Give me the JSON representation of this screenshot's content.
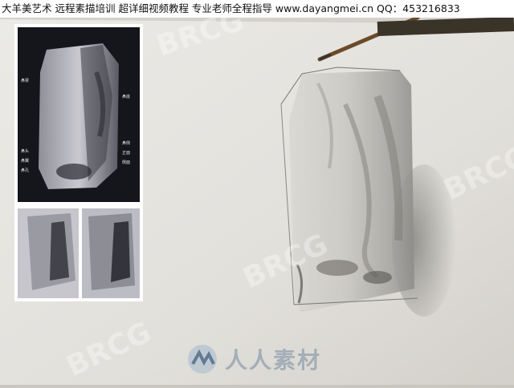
{
  "banner": {
    "text": "大羊美艺术 远程素描培训 超详细视频教程 专业老师全程指导  www.dayangmei.cn  QQ：453216833"
  },
  "watermarks": {
    "brand_text": "BRCG",
    "logo_text": "人人素材"
  },
  "reference_photo": {
    "labels_left": [
      "鼻梁",
      "鼻头",
      "鼻翼",
      "鼻孔"
    ],
    "labels_right": [
      "鼻底",
      "鼻侧",
      "正面",
      "侧面"
    ]
  },
  "colors": {
    "paper": "#e6e4df",
    "graphite": "#5a5a5a",
    "photo_dark": "#1a1a22"
  }
}
